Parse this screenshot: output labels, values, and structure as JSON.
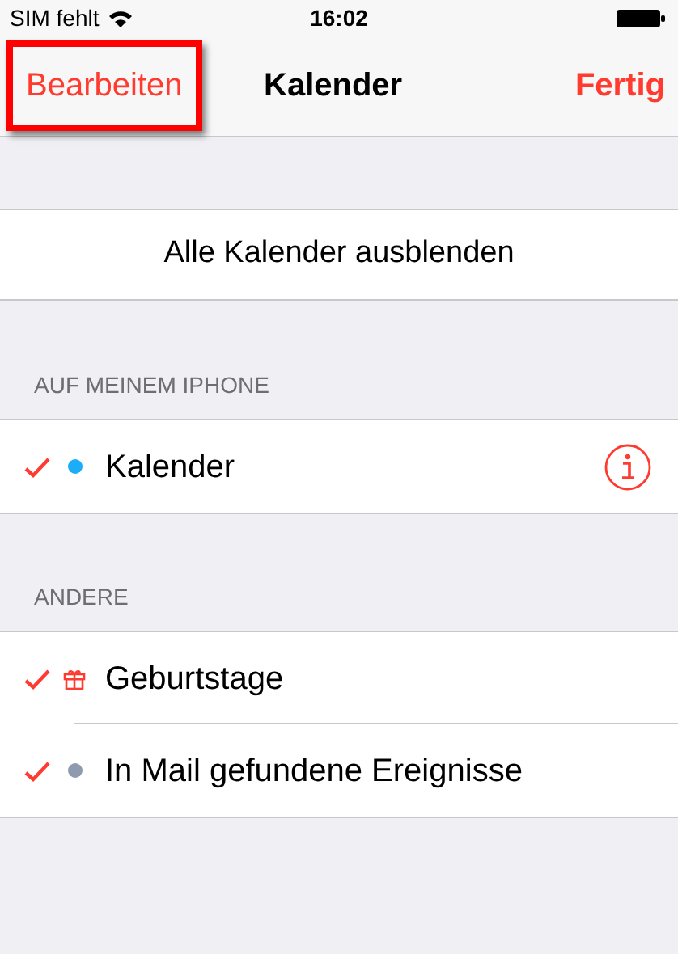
{
  "status_bar": {
    "carrier": "SIM fehlt",
    "time": "16:02"
  },
  "nav": {
    "left": {
      "label": "Bearbeiten",
      "highlighted": true
    },
    "title": "Kalender",
    "right": "Fertig"
  },
  "hide_all": "Alle Kalender ausblenden",
  "sections": [
    {
      "header": "AUF MEINEM IPHONE",
      "items": [
        {
          "label": "Kalender",
          "checked": true,
          "kind": "dot",
          "color": "#1badf8",
          "info": true
        }
      ]
    },
    {
      "header": "ANDERE",
      "items": [
        {
          "label": "Geburtstage",
          "checked": true,
          "kind": "gift",
          "color": "#ff3b30",
          "info": false
        },
        {
          "label": "In Mail gefundene Ereignisse",
          "checked": true,
          "kind": "dot",
          "color": "#8e9aaf",
          "info": false
        }
      ]
    }
  ]
}
